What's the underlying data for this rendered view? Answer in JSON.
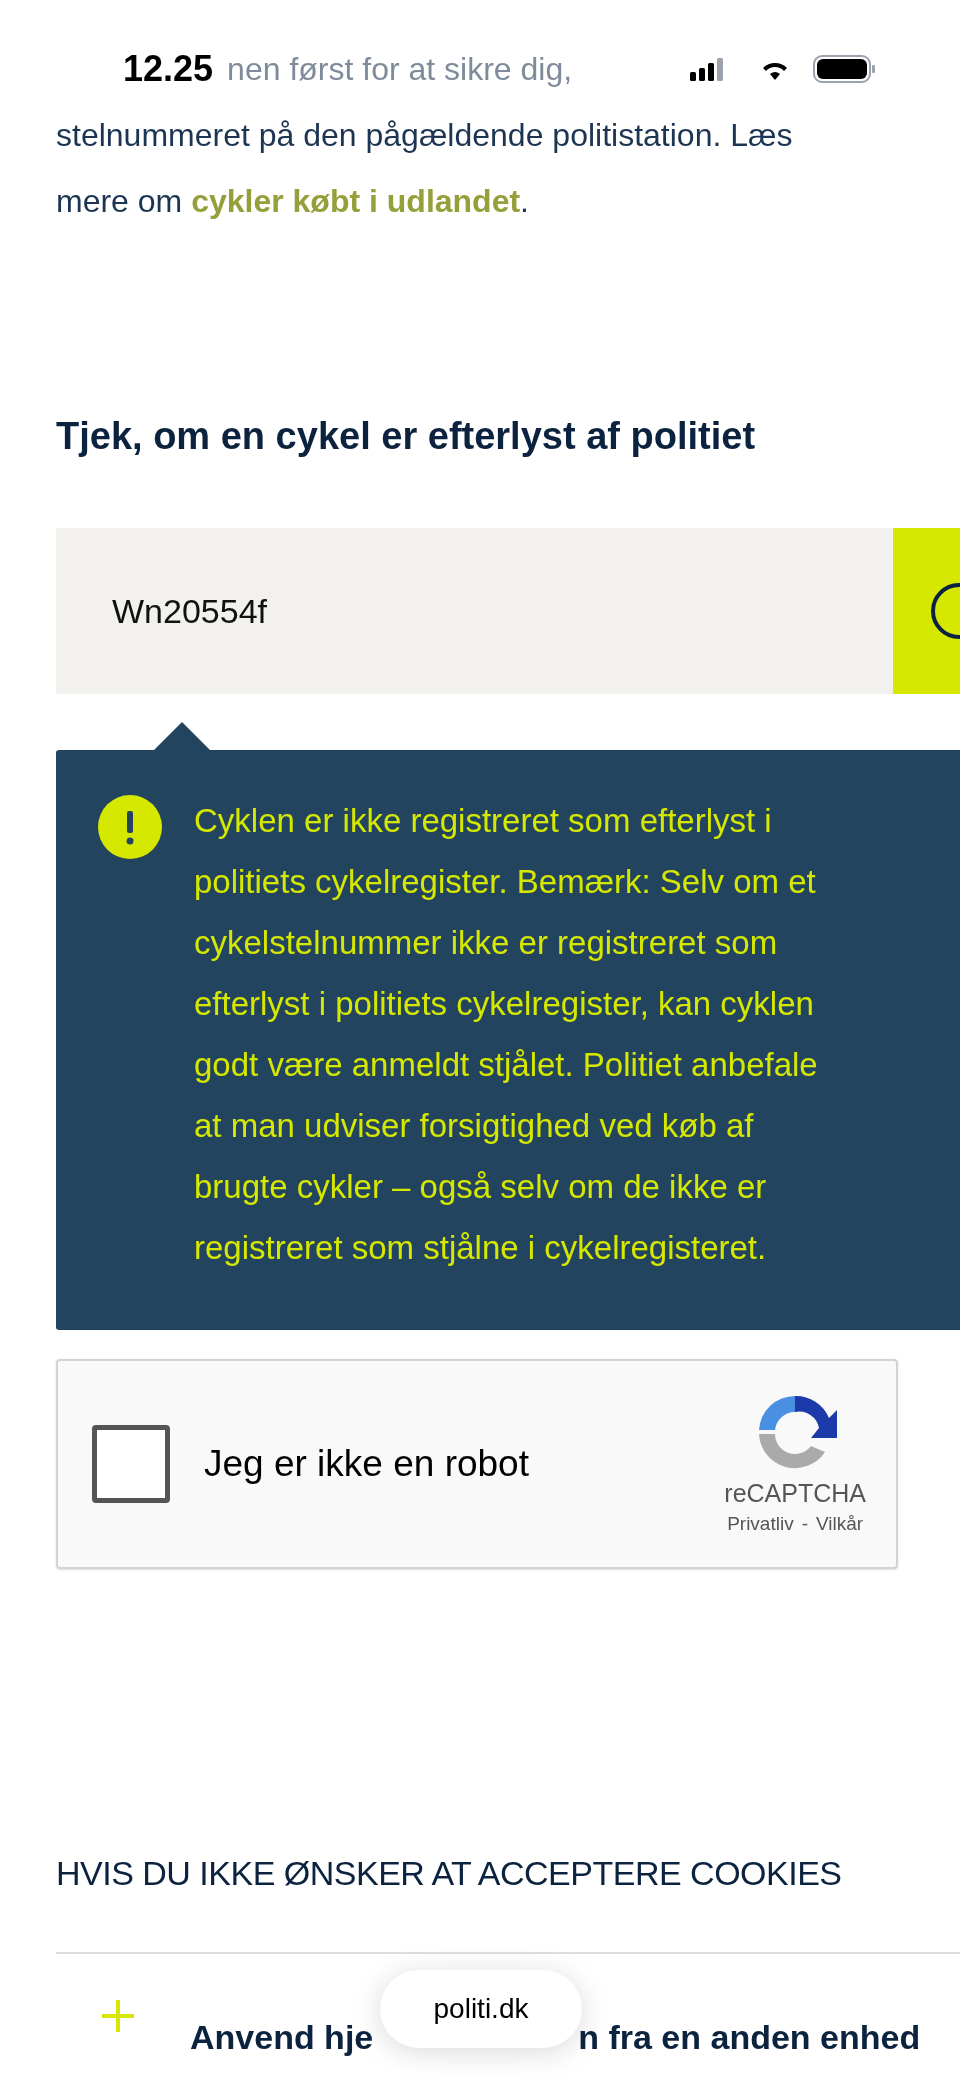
{
  "status_bar": {
    "time": "12.25"
  },
  "intro": {
    "covered_fragment": "nen først for at sikre dig,",
    "lines": [
      "stelnummeret på den pågældende politistation. Læs"
    ],
    "last_line_prefix": "mere om",
    "link": "cykler købt i udlandet",
    "last_line_suffix": "."
  },
  "check": {
    "title": "Tjek, om en cykel er efterlyst af politiet",
    "search_value": "Wn20554f"
  },
  "alert": {
    "lines": [
      "Cyklen er ikke registreret som efterlyst i",
      "politiets cykelregister. Bemærk: Selv om et",
      "cykelstelnummer ikke er registreret som",
      "efterlyst i politiets cykelregister, kan cyklen",
      "godt være anmeldt stjålet. Politiet anbefale",
      "at man udviser forsigtighed ved køb af",
      "brugte cykler – også selv om de ikke er",
      "registreret som stjålne i cykelregisteret."
    ]
  },
  "recaptcha": {
    "checked": false,
    "label": "Jeg er ikke en robot",
    "brand": "reCAPTCHA",
    "privacy": "Privatliv",
    "separator": "-",
    "terms": "Vilkår"
  },
  "cookies": {
    "title": "HVIS DU IKKE ØNSKER AT ACCEPTERE COOKIES",
    "items": [
      {
        "label_start": "Anvend hje",
        "label_end": "n fra en anden enhed",
        "expanded": false
      }
    ]
  },
  "browser": {
    "address": "politi.dk"
  }
}
